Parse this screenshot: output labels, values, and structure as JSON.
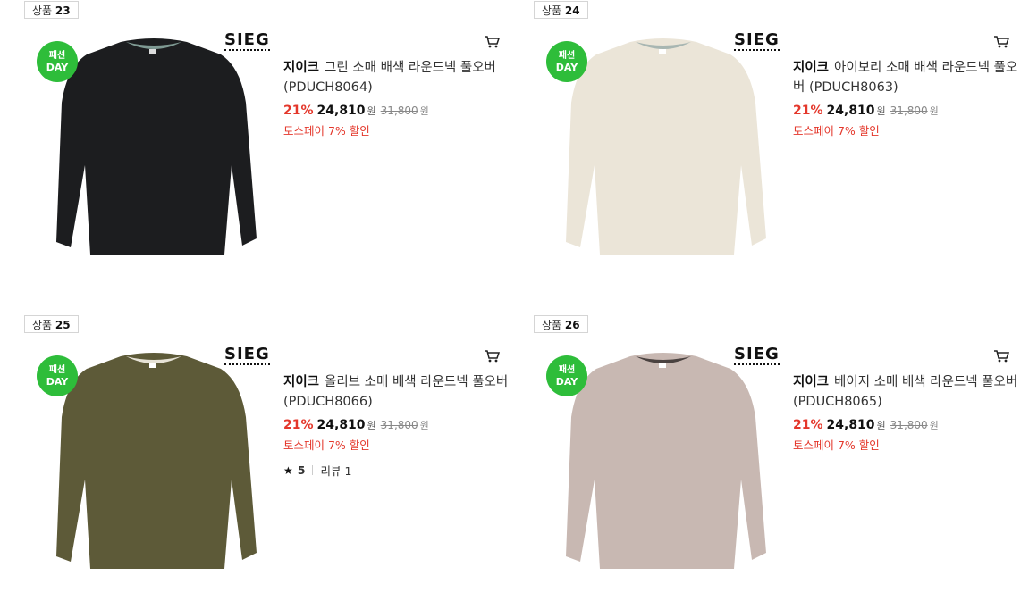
{
  "products": [
    {
      "rank_label": "상품",
      "rank_num": "23",
      "badge_line1": "패션",
      "badge_line2": "DAY",
      "brand_logo": "SIEG",
      "maker": "지이크",
      "name": "그린 소매 배색 라운드넥 풀오버 (PDUCH8064)",
      "discount": "21%",
      "price": "24,810",
      "won": "원",
      "original_price": "31,800",
      "original_won": "원",
      "toss_benefit": "토스페이 7% 할인",
      "color": "#1c1d1f",
      "collar_color": "#7f9a93"
    },
    {
      "rank_label": "상품",
      "rank_num": "24",
      "badge_line1": "패션",
      "badge_line2": "DAY",
      "brand_logo": "SIEG",
      "maker": "지이크",
      "name": "아이보리 소매 배색 라운드넥 풀오버 (PDUCH8063)",
      "discount": "21%",
      "price": "24,810",
      "won": "원",
      "original_price": "31,800",
      "original_won": "원",
      "toss_benefit": "토스페이 7% 할인",
      "color": "#ebe5d8",
      "collar_color": "#a8b6b2"
    },
    {
      "rank_label": "상품",
      "rank_num": "25",
      "badge_line1": "패션",
      "badge_line2": "DAY",
      "brand_logo": "SIEG",
      "maker": "지이크",
      "name": "올리브 소매 배색 라운드넥 풀오버 (PDUCH8066)",
      "discount": "21%",
      "price": "24,810",
      "won": "원",
      "original_price": "31,800",
      "original_won": "원",
      "toss_benefit": "토스페이 7% 할인",
      "rating": "5",
      "review_label": "리뷰 1",
      "color": "#5d5a38",
      "collar_color": "#e6e2d6"
    },
    {
      "rank_label": "상품",
      "rank_num": "26",
      "badge_line1": "패션",
      "badge_line2": "DAY",
      "brand_logo": "SIEG",
      "maker": "지이크",
      "name": "베이지 소매 배색 라운드넥 풀오버 (PDUCH8065)",
      "discount": "21%",
      "price": "24,810",
      "won": "원",
      "original_price": "31,800",
      "original_won": "원",
      "toss_benefit": "토스페이 7% 할인",
      "color": "#c8b8b2",
      "collar_color": "#4a4240"
    }
  ],
  "icons": {
    "cart": "cart-icon",
    "star": "star-icon"
  },
  "accent_red": "#e4372b",
  "badge_green": "#2ebd3a"
}
